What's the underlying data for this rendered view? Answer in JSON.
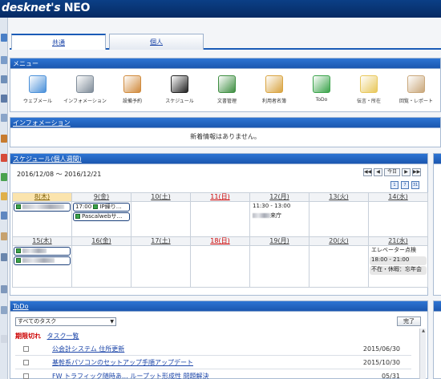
{
  "app": {
    "logo_prefix": "desknet's",
    "logo_suffix": "NEO"
  },
  "tabs": [
    {
      "label": "共通",
      "active": true
    },
    {
      "label": "個人",
      "active": false
    }
  ],
  "menu": {
    "title": "メニュー",
    "items": [
      {
        "label": "ウェブメール",
        "icon": "mail-icon",
        "color": "#4a90d9"
      },
      {
        "label": "インフォメーション",
        "icon": "information-icon",
        "color": "#7f8c99"
      },
      {
        "label": "設備予約",
        "icon": "facility-icon",
        "color": "#d08a3c"
      },
      {
        "label": "スケジュール",
        "icon": "calendar-icon",
        "color": "#222222"
      },
      {
        "label": "文書管理",
        "icon": "documents-icon",
        "color": "#3e8e41"
      },
      {
        "label": "利用者名簿",
        "icon": "directory-icon",
        "color": "#d9a441"
      },
      {
        "label": "ToDo",
        "icon": "todo-icon",
        "color": "#3aa34a"
      },
      {
        "label": "伝言・所在",
        "icon": "memo-icon",
        "color": "#e8c75a"
      },
      {
        "label": "回覧・レポート",
        "icon": "report-icon",
        "color": "#c9a77a"
      }
    ]
  },
  "information": {
    "title": "インフォメーション",
    "message": "新着情報はありません。"
  },
  "schedule": {
    "title": "スケジュール(個人週間)",
    "range": "2016/12/08 ～ 2016/12/21",
    "nav_buttons": [
      "◀◀",
      "◀",
      "今日",
      "▶",
      "▶▶"
    ],
    "view_buttons": [
      "1",
      "7",
      "31"
    ],
    "week1": [
      {
        "day": "8(木)",
        "kind": "today",
        "events": [
          {
            "type": "blur",
            "w": 52
          }
        ]
      },
      {
        "day": "9(金)",
        "kind": "normal",
        "events": [
          {
            "type": "text",
            "text": "17:00 ",
            "tail": "IP繰り…",
            "icon": true
          },
          {
            "type": "text",
            "text": "",
            "tail": "Pascalwebサ…",
            "icon": true
          }
        ]
      },
      {
        "day": "10(土)",
        "kind": "sat",
        "events": []
      },
      {
        "day": "11(日)",
        "kind": "sun",
        "events": []
      },
      {
        "day": "12(月)",
        "kind": "normal",
        "events": [
          {
            "type": "plain",
            "text": "11:30 - 13:00"
          },
          {
            "type": "plainblur",
            "tail": "来庁"
          }
        ]
      },
      {
        "day": "13(火)",
        "kind": "normal",
        "events": []
      },
      {
        "day": "14(水)",
        "kind": "normal",
        "events": []
      }
    ],
    "week2": [
      {
        "day": "15(木)",
        "kind": "normal",
        "events": [
          {
            "type": "blur",
            "w": 30
          },
          {
            "type": "blur",
            "w": 40
          }
        ]
      },
      {
        "day": "16(金)",
        "kind": "normal",
        "events": []
      },
      {
        "day": "17(土)",
        "kind": "sat",
        "events": []
      },
      {
        "day": "18(日)",
        "kind": "sun",
        "events": []
      },
      {
        "day": "19(月)",
        "kind": "normal",
        "events": []
      },
      {
        "day": "20(火)",
        "kind": "normal",
        "events": []
      },
      {
        "day": "21(水)",
        "kind": "normal",
        "events": [
          {
            "type": "plain",
            "text": "エレベーター点検"
          },
          {
            "type": "gray",
            "text": "18:00 - 21:00"
          },
          {
            "type": "gray",
            "text": "不在・休暇：忘年会"
          }
        ]
      }
    ]
  },
  "todo": {
    "title": "ToDo",
    "filter": "すべてのタスク",
    "done_label": "完了",
    "overdue_label": "期限切れ",
    "list_link": "タスク一覧",
    "rows": [
      {
        "title": "公会計システム 住所更新",
        "date": "2015/06/30"
      },
      {
        "title": "基幹系パソコンのセットアップ手順アップデート",
        "date": "2015/10/30"
      },
      {
        "title": "FW トラフィック随時あ… ループット形成性 問題解決",
        "date": "05/31"
      }
    ]
  }
}
